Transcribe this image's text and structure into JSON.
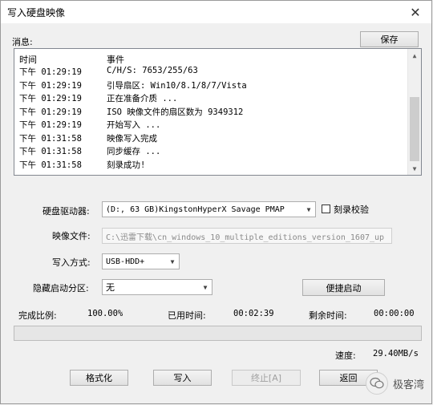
{
  "window": {
    "title": "写入硬盘映像",
    "close_glyph": "✕"
  },
  "messages": {
    "label": "消息:",
    "save_button": "保存",
    "header": {
      "time": "时间",
      "event": "事件"
    },
    "rows": [
      {
        "time": "下午 01:29:19",
        "event": "C/H/S: 7653/255/63"
      },
      {
        "time": "下午 01:29:19",
        "event": "引导扇区: Win10/8.1/8/7/Vista"
      },
      {
        "time": "下午 01:29:19",
        "event": "正在准备介质 ..."
      },
      {
        "time": "下午 01:29:19",
        "event": "ISO 映像文件的扇区数为 9349312"
      },
      {
        "time": "下午 01:29:19",
        "event": "开始写入 ..."
      },
      {
        "time": "下午 01:31:58",
        "event": "映像写入完成"
      },
      {
        "time": "下午 01:31:58",
        "event": "同步缓存 ..."
      },
      {
        "time": "下午 01:31:58",
        "event": "刻录成功!"
      }
    ]
  },
  "form": {
    "drive_label": "硬盘驱动器:",
    "drive_value": "(D:, 63 GB)KingstonHyperX Savage   PMAP",
    "verify_label": "刻录校验",
    "image_label": "映像文件:",
    "image_value": "C:\\迅雷下载\\cn_windows_10_multiple_editions_version_1607_up",
    "write_method_label": "写入方式:",
    "write_method_value": "USB-HDD+",
    "hidden_partition_label": "隐藏启动分区:",
    "hidden_partition_value": "无",
    "quick_boot_button": "便捷启动"
  },
  "status": {
    "completion_label": "完成比例:",
    "completion_value": "100.00%",
    "elapsed_label": "已用时间:",
    "elapsed_value": "00:02:39",
    "remaining_label": "剩余时间:",
    "remaining_value": "00:00:00",
    "speed_label": "速度:",
    "speed_value": "29.40MB/s",
    "progress_fraction": 1.0
  },
  "buttons": {
    "format": "格式化",
    "write": "写入",
    "abort": "终止[A]",
    "back": "返回"
  },
  "watermark": {
    "text": "极客湾",
    "icon": "wechat-icon"
  }
}
